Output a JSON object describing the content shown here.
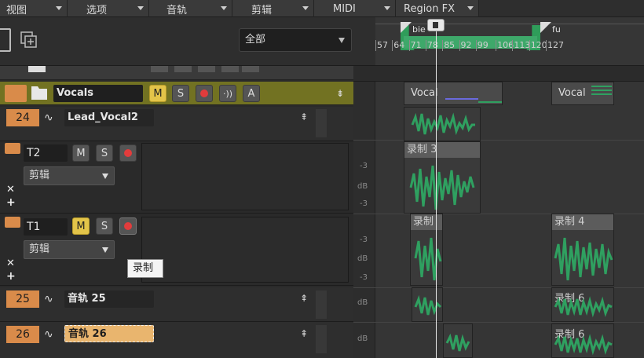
{
  "menu": [
    "视图",
    "选项",
    "音轨",
    "剪辑",
    "MIDI",
    "Region FX"
  ],
  "toolbar": {
    "filter_value": "全部"
  },
  "ruler": {
    "marker_bie": "bie",
    "marker_fu": "fu",
    "ticks": [
      "57",
      "64",
      "71",
      "78",
      "85",
      "92",
      "99",
      "106",
      "113",
      "120",
      "127"
    ]
  },
  "folder": {
    "name": "Vocals",
    "m": "M",
    "s": "S",
    "a": "A"
  },
  "tracks": {
    "t24": {
      "num": "24",
      "name": "Lead_Vocal2"
    },
    "t2": {
      "name": "T2",
      "m": "M",
      "s": "S",
      "edit": "剪辑"
    },
    "t1": {
      "name": "T1",
      "m": "M",
      "s": "S",
      "edit": "剪辑"
    },
    "t25": {
      "num": "25",
      "name": "音轨 25"
    },
    "t26": {
      "num": "26",
      "name": "音轨 26"
    }
  },
  "tooltip": "录制",
  "clips": {
    "vocal1": "Vocal",
    "vocal2": "Vocal",
    "rec3": "录制 3",
    "rec_t1": "录制",
    "rec4": "录制 4",
    "rec6a": "录制 6",
    "rec6b": "录制 6"
  },
  "db_labels": {
    "minus3": "-3",
    "db": "dB"
  },
  "colors": {
    "accent_orange": "#d98b4a",
    "folder_olive": "#7a7a2a",
    "wave_green": "#2fa060",
    "mute_yellow": "#e3c449"
  }
}
